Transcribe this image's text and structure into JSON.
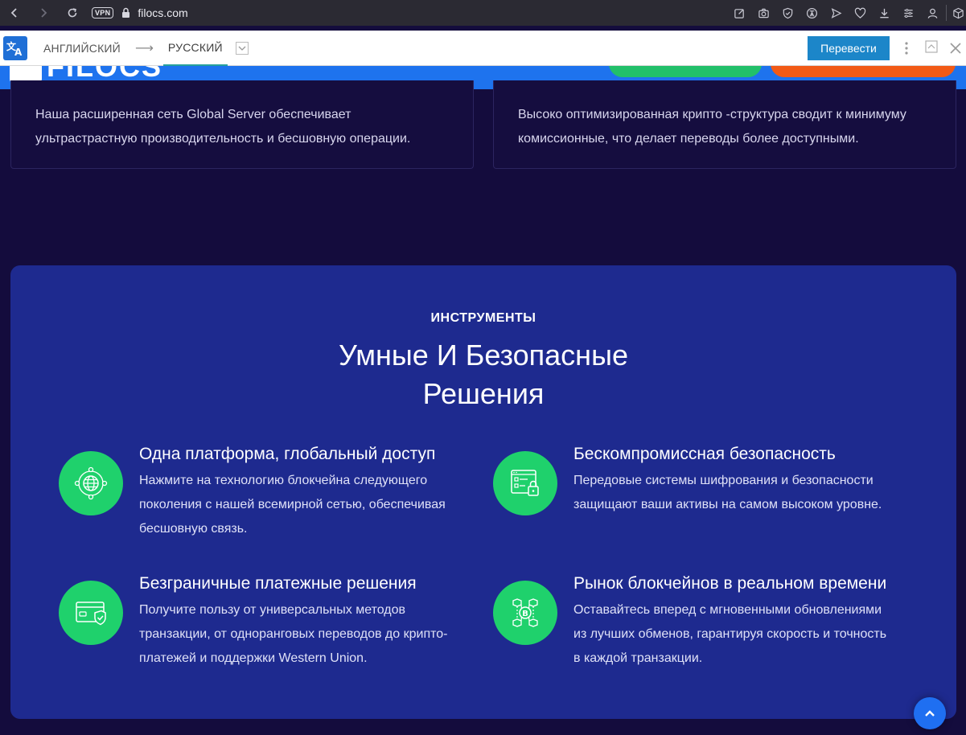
{
  "browser": {
    "vpn_label": "VPN",
    "url": "filocs.com",
    "icons": [
      "back-icon",
      "forward-icon",
      "reload-icon",
      "lock-icon",
      "edit-icon",
      "camera-icon",
      "shield-icon",
      "translate-icon",
      "send-icon",
      "heart-icon",
      "download-icon",
      "menu-icon",
      "profile-icon",
      "cube-icon"
    ]
  },
  "translate_bar": {
    "from_lang": "АНГЛИЙСКИЙ",
    "arrow": "⟶",
    "to_lang": "РУССКИЙ",
    "translate_button": "Перевести"
  },
  "site_header": {
    "logo_text": "FILOCS"
  },
  "top_cards": [
    {
      "desc": "Наша расширенная сеть Global Server обеспечивает ультрастрастную производительность и бесшовную операции."
    },
    {
      "desc": "Высоко оптимизированная крипто -структура сводит к минимуму комиссионные, что делает переводы более доступными."
    }
  ],
  "tools": {
    "eyebrow": "ИНСТРУМЕНТЫ",
    "title_line1": "Умные И Безопасные",
    "title_line2": "Решения",
    "features": [
      {
        "icon": "globe-network-icon",
        "title": "Одна платформа, глобальный доступ",
        "desc": "Нажмите на технологию блокчейна следующего поколения с нашей всемирной сетью, обеспечивая бесшовную связь."
      },
      {
        "icon": "secure-checklist-icon",
        "title": "Бескомпромиссная безопасность",
        "desc": "Передовые системы шифрования и безопасности защищают ваши активы на самом высоком уровне."
      },
      {
        "icon": "payment-card-shield-icon",
        "title": "Безграничные платежные решения",
        "desc": "Получите пользу от универсальных методов транзакции, от одноранговых переводов до крипто-платежей и поддержки Western Union."
      },
      {
        "icon": "blockchain-bitcoin-icon",
        "title": "Рынок блокчейнов в реальном времени",
        "desc": "Оставайтесь вперед с мгновенными обновлениями из лучших обменов, гарантируя скорость и точность в каждой транзакции."
      }
    ]
  },
  "colors": {
    "page_bg": "#140c3d",
    "panel_bg": "#1e2a8f",
    "accent_green": "#1fd16c",
    "header_blue": "#1e73ee",
    "header_orange": "#f25a16",
    "translate_button": "#1c86c9"
  }
}
